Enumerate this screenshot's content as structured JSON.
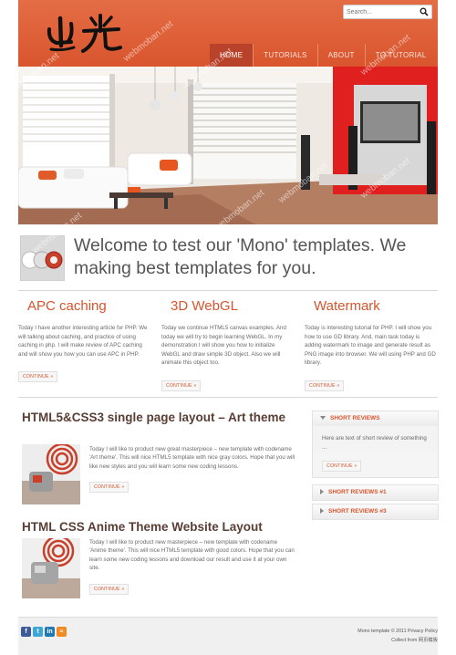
{
  "header": {
    "logo_text": "出光",
    "search": {
      "placeholder": "Search..."
    },
    "nav": [
      "HOME",
      "TUTORIALS",
      "ABOUT",
      "TO TUTORIAL"
    ]
  },
  "watermark": "webmoban.net",
  "welcome": {
    "text": "Welcome to test our 'Mono' templates. We making best templates for you."
  },
  "columns": [
    {
      "title": "APC caching",
      "text": "Today I have another interesting article for PHP. We will talking about caching, and practice of using caching in php. I will make review of APC caching and will show you how you can use APC in PHP.",
      "button": "CONTINUE »"
    },
    {
      "title": "3D WebGL",
      "text": "Today we continue HTML5 canvas examples. And today we will try to begin learning WebGL. In my demonstration I will show you how to initialize WebGL and draw simple 3D object. Also we will animate this object too.",
      "button": "CONTINUE »"
    },
    {
      "title": "Watermark",
      "text": "Today is interesting tutorial for PHP. I will show you how to use GD library. And, main task today is adding watermark to image and generate result as PNG image into browser. We will using PHP and GD library.",
      "button": "CONTINUE »"
    }
  ],
  "articles": [
    {
      "title": "HTML5&CSS3 single page layout – Art theme",
      "text": "Today I will like to product new great masterpiece – new template with codename 'Art theme'. This will nice HTML5 template with nice gray colors. Hope that you will like new styles and you will learn some new coding lessons.",
      "button": "CONTINUE »"
    },
    {
      "title": "HTML CSS Anime Theme Website Layout",
      "text": "Today I will like to product new masterpiece – new template with codename 'Anime theme'. This will nice HTML5 template with good colors. Hope that you can learn some new coding lessons and download our result and use it at your own site.",
      "button": "CONTINUE »"
    }
  ],
  "sidebar": {
    "reviews": [
      {
        "title": "SHORT REVIEWS",
        "text": "Here are text of short review of something ...",
        "button": "CONTINUE »",
        "expanded": true
      },
      {
        "title": "SHORT REVIEWS #1",
        "expanded": false
      },
      {
        "title": "SHORT REVIEWS #3",
        "expanded": false
      }
    ]
  },
  "footer": {
    "social": [
      "facebook-icon",
      "twitter-icon",
      "linkedin-icon",
      "rss-icon"
    ],
    "line1": "Mono template © 2011 Privacy Policy",
    "line2": "Collect from 网页模板"
  },
  "colors": {
    "accent": "#d8542c",
    "header": "#e0613a",
    "nav_active": "#b8432a"
  }
}
